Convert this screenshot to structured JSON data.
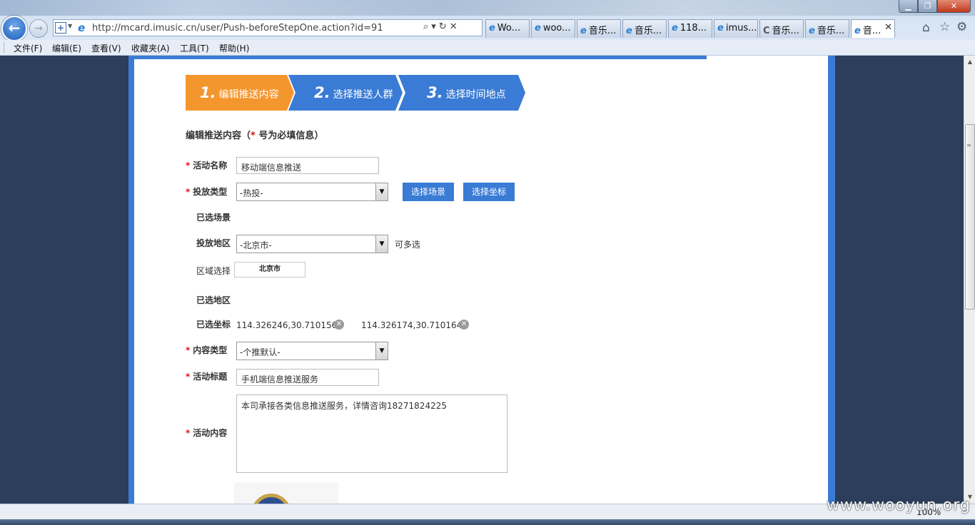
{
  "browser": {
    "address": {
      "url": "http://mcard.imusic.cn/user/Push-beforeStepOne.action?id=91",
      "tools": "⌕▾↻✕"
    },
    "tabs": [
      {
        "label": "Wo..."
      },
      {
        "label": "woo..."
      },
      {
        "label": "音乐..."
      },
      {
        "label": "音乐..."
      },
      {
        "label": "118..."
      },
      {
        "label": "imus..."
      },
      {
        "label": "音乐..."
      },
      {
        "label": "音乐..."
      },
      {
        "label": "音..."
      }
    ],
    "menu": [
      "文件(F)",
      "编辑(E)",
      "查看(V)",
      "收藏夹(A)",
      "工具(T)",
      "帮助(H)"
    ],
    "zoom": "100%",
    "icons": {
      "back": "back-arrow-icon",
      "forward": "forward-arrow-icon",
      "home": "home-icon",
      "favorites": "star-icon",
      "tools": "gear-icon"
    }
  },
  "steps": [
    {
      "num": "1.",
      "label": "编辑推送内容"
    },
    {
      "num": "2.",
      "label": "选择推送人群"
    },
    {
      "num": "3.",
      "label": "选择时间地点"
    }
  ],
  "form": {
    "heading_prefix": "编辑推送内容（",
    "heading_star": "*",
    "heading_suffix": " 号为必填信息）",
    "required_mark": "*",
    "activity_name": {
      "label": "活动名称",
      "value": "移动端信息推送"
    },
    "delivery_type": {
      "label": "投放类型",
      "value": "-热投-"
    },
    "select_scene_button": "选择场景",
    "select_coords_button": "选择坐标",
    "selected_scene_label": "已选场景",
    "delivery_region": {
      "label": "投放地区",
      "value": "-北京市-",
      "hint": "可多选"
    },
    "area_select": {
      "label": "区域选择",
      "chip": "北京市"
    },
    "selected_region_label": "已选地区",
    "selected_coords": {
      "label": "已选坐标",
      "items": [
        "114.326246,30.710156",
        "114.326174,30.710164"
      ]
    },
    "content_type": {
      "label": "内容类型",
      "value": "-个推默认-"
    },
    "activity_title": {
      "label": "活动标题",
      "value": "手机端信息推送服务"
    },
    "activity_content": {
      "label": "活动内容",
      "value": "本司承接各类信息推送服务，详情咨询18271824225"
    }
  },
  "watermark": "www.wooyun.org",
  "colors": {
    "accent_blue": "#3a7bd5",
    "step_active": "#f4962e",
    "required": "#e01010",
    "page_bg": "#2c3e5c"
  }
}
